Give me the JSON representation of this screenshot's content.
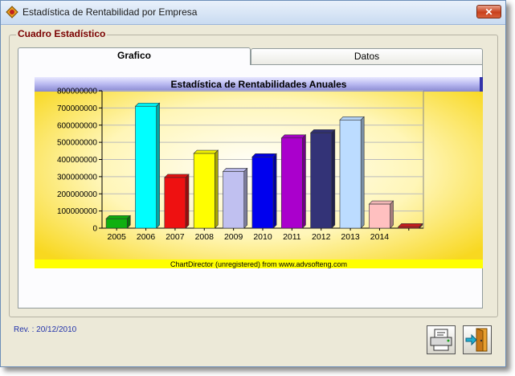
{
  "window": {
    "title": "Estadística de Rentabilidad por Empresa",
    "close_label": "✕"
  },
  "group": {
    "label": "Cuadro Estadístico"
  },
  "tabs": [
    {
      "label": "Grafico"
    },
    {
      "label": "Datos"
    }
  ],
  "footer": {
    "revision": "Rev. : 20/12/2010"
  },
  "icons": {
    "app": "app-icon",
    "print": "print-icon",
    "exit": "exit-door-icon"
  },
  "chart_data": {
    "type": "bar",
    "title": "Estadística de Rentabilidades Anuales",
    "footnote": "ChartDirector (unregistered) from www.advsofteng.com",
    "xlabel": "",
    "ylabel": "",
    "ylim": [
      0,
      800000000
    ],
    "yticks": [
      "800000000",
      "700000000",
      "600000000",
      "500000000",
      "400000000",
      "300000000",
      "200000000",
      "100000000",
      "0"
    ],
    "grid": true,
    "categories": [
      "2005",
      "2006",
      "2007",
      "2008",
      "2009",
      "2010",
      "2011",
      "2012",
      "2013",
      "2014",
      ""
    ],
    "values": [
      55000000,
      710000000,
      295000000,
      435000000,
      330000000,
      415000000,
      525000000,
      555000000,
      630000000,
      140000000,
      8000000
    ],
    "colors": [
      "#10b010",
      "#00ffff",
      "#ee1111",
      "#ffff00",
      "#c0c0f0",
      "#0000ee",
      "#aa00cc",
      "#333377",
      "#bcdcff",
      "#ffc0c0",
      "#cc2020"
    ]
  }
}
